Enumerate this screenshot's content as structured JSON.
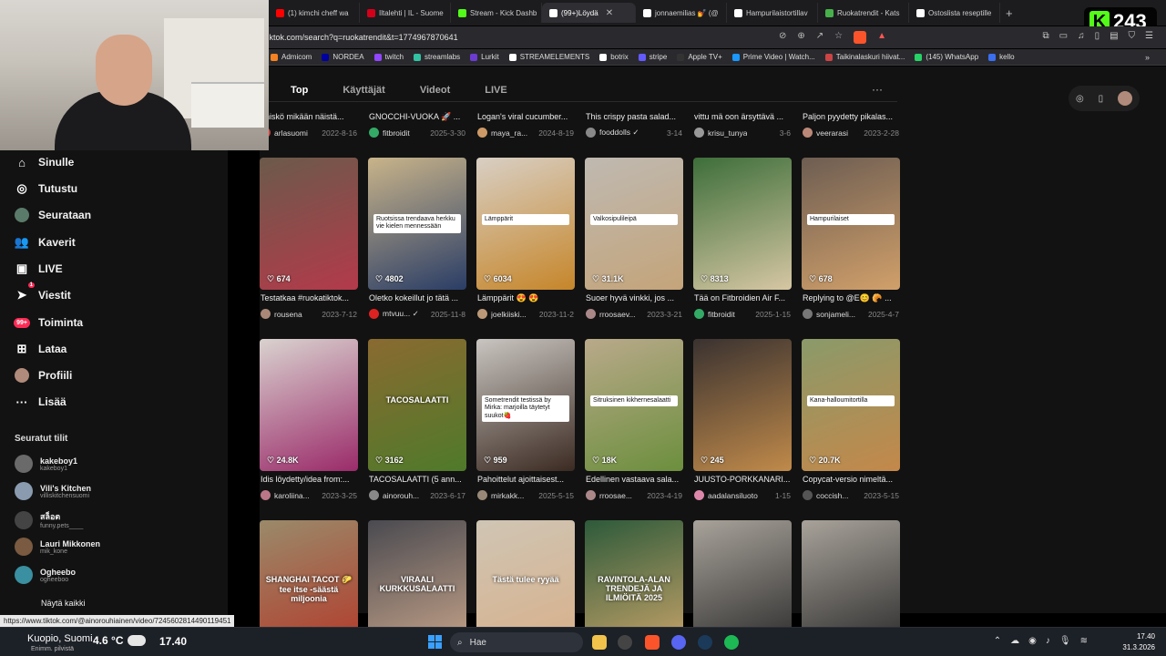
{
  "browser": {
    "tabs": [
      {
        "label": "(1) kimchi cheff wa",
        "color": "#ff0000",
        "active": false
      },
      {
        "label": "Iltalehti | IL - Suome",
        "color": "#d4001a",
        "active": false
      },
      {
        "label": "Stream - Kick Dashb",
        "color": "#53fc18",
        "active": false
      },
      {
        "label": "(99+)Löydä",
        "color": "#ffffff",
        "active": true
      },
      {
        "label": "jonnaemilias 💅 (@",
        "color": "#ffffff",
        "active": false
      },
      {
        "label": "Hampurilaistortillav",
        "color": "#ffffff",
        "active": false
      },
      {
        "label": "Ruokatrendit - Kats",
        "color": "#47b04b",
        "active": false
      },
      {
        "label": "Ostoslista reseptille",
        "color": "#ffffff",
        "active": false
      }
    ],
    "new_tab": "+",
    "kick_viewers": "243",
    "url": "tiktok.com/search?q=ruokatrendit&t=1774967870641",
    "bookmarks": [
      {
        "label": "Admicom",
        "color": "#f58220"
      },
      {
        "label": "NORDEA",
        "color": "#0000a0"
      },
      {
        "label": "twitch",
        "color": "#9146ff"
      },
      {
        "label": "streamlabs",
        "color": "#31c3a2"
      },
      {
        "label": "Lurkit",
        "color": "#6c3bd1"
      },
      {
        "label": "STREAMELEMENTS",
        "color": "#ffffff"
      },
      {
        "label": "botrix",
        "color": "#ffffff"
      },
      {
        "label": "stripe",
        "color": "#635bff"
      },
      {
        "label": "Apple TV+",
        "color": "#333333"
      },
      {
        "label": "Prime Video | Watch...",
        "color": "#1a98ff"
      },
      {
        "label": "Taikinalaskuri hiivat...",
        "color": "#cc4444"
      },
      {
        "label": "(145) WhatsApp",
        "color": "#25d366"
      },
      {
        "label": "kello",
        "color": "#3a6ff0"
      }
    ],
    "bookmarks_more": "»"
  },
  "sidebar": {
    "nav": [
      {
        "label": "Sinulle",
        "icon": "⌂",
        "badge": ""
      },
      {
        "label": "Tutustu",
        "icon": "◎",
        "badge": ""
      },
      {
        "label": "Seurataan",
        "icon": "●",
        "badge": ""
      },
      {
        "label": "Kaverit",
        "icon": "👥",
        "badge": ""
      },
      {
        "label": "LIVE",
        "icon": "▣",
        "badge": ""
      },
      {
        "label": "Viestit",
        "icon": "➤",
        "badge": "1"
      },
      {
        "label": "Toiminta",
        "icon": "●",
        "badge": "99+"
      },
      {
        "label": "Lataa",
        "icon": "⊞",
        "badge": ""
      },
      {
        "label": "Profiili",
        "icon": "●",
        "badge": ""
      },
      {
        "label": "Lisää",
        "icon": "···",
        "badge": ""
      }
    ],
    "followed_title": "Seuratut tilit",
    "accounts": [
      {
        "name": "kakeboy1",
        "handle": "kakeboy1",
        "color": "#6a6a6a"
      },
      {
        "name": "Vili's Kitchen",
        "handle": "villiskitchensuomi",
        "color": "#8a9bb0"
      },
      {
        "name": "สล็อต",
        "handle": "funny.pets____",
        "color": "#444444"
      },
      {
        "name": "Lauri Mikkonen",
        "handle": "mik_kone",
        "color": "#7a5a40"
      },
      {
        "name": "Ogheebo",
        "handle": "ogheeboo",
        "color": "#3a8fa0"
      }
    ],
    "show_all": "Näytä kaikki"
  },
  "search": {
    "tabs": [
      "Top",
      "Käyttäjät",
      "Videot",
      "LIVE"
    ],
    "more": "···",
    "rows": [
      {
        "cards": [
          {
            "caption": "eniskö mikään näistä...",
            "user": "arlasuomi",
            "date": "2022-8-16",
            "views": "",
            "av": "#c44"
          },
          {
            "caption": "GNOCCHI-VUOKA 🚀 ...",
            "user": "fitbroidit",
            "date": "2025-3-30",
            "views": "",
            "av": "#3a6"
          },
          {
            "caption": "Logan's viral cucumber...",
            "user": "maya_ra...",
            "date": "2024-8-19",
            "views": "",
            "av": "#c96"
          },
          {
            "caption": "This crispy pasta salad...",
            "user": "fooddolls ✓",
            "date": "3-14",
            "views": "",
            "av": "#888"
          },
          {
            "caption": "vittu mä oon ärsyttävä ...",
            "user": "krisu_tunya",
            "date": "3-6",
            "views": "",
            "av": "#999"
          },
          {
            "caption": "Paljon pyydetty pikalas...",
            "user": "veerarasi",
            "date": "2023-2-28",
            "views": "",
            "av": "#b87"
          }
        ]
      },
      {
        "cards": [
          {
            "caption": "Testatkaa #ruokatiktok...",
            "user": "rousena",
            "date": "2023-7-12",
            "views": "674",
            "av": "#a87",
            "bg": "#6b5a4a",
            "bg2": "#b33a4a",
            "overlay": ""
          },
          {
            "caption": "Oletko kokeillut jo tätä ...",
            "user": "mtvuu... ✓",
            "date": "2025-11-8",
            "views": "4802",
            "av": "#d22",
            "bg": "#c9b48a",
            "bg2": "#2a3d66",
            "overlay": "Ruotsissa trendaava herkku vie kielen mennessään"
          },
          {
            "caption": "Lämppärit 😍 😍",
            "user": "joelkiiski...",
            "date": "2023-11-2",
            "views": "6034",
            "av": "#b97",
            "bg": "#d8cfc4",
            "bg2": "#c6862a",
            "overlay": "Lämppärit"
          },
          {
            "caption": "Suoer hyvä vinkki, jos ...",
            "user": "rroosaev...",
            "date": "2023-3-21",
            "views": "31.1K",
            "av": "#a88",
            "bg": "#bfb9b1",
            "bg2": "#c4a47a",
            "overlay": "Valkosipulileipä"
          },
          {
            "caption": "Tää on Fitbroidien Air F...",
            "user": "fitbroidit",
            "date": "2025-1-15",
            "views": "8313",
            "av": "#3a6",
            "bg": "#3d6e3a",
            "bg2": "#d6c7a3",
            "overlay": ""
          },
          {
            "caption": "Replying to @E😊 🥐 ...",
            "user": "sonjameli...",
            "date": "2025-4-7",
            "views": "678",
            "av": "#777",
            "bg": "#6d5d52",
            "bg2": "#d1a06a",
            "overlay": "Hampurilaiset"
          }
        ]
      },
      {
        "cards": [
          {
            "caption": "Idis löydetty/idea from:...",
            "user": "karoliina...",
            "date": "2023-3-25",
            "views": "24.8K",
            "av": "#b78",
            "bg": "#d9d2cf",
            "bg2": "#9b2b6a",
            "overlay": ""
          },
          {
            "caption": "TACOSALAATTI (5 ann...",
            "user": "ainorouh...",
            "date": "2023-6-17",
            "views": "3162",
            "av": "#888",
            "bg": "#8a6a30",
            "bg2": "#4f7a2a",
            "overlay": "TACOSALAATTI"
          },
          {
            "caption": "Pahoittelut ajoittaisest...",
            "user": "mirkakk...",
            "date": "2025-5-15",
            "views": "959",
            "av": "#987",
            "bg": "#c9c5c0",
            "bg2": "#3b2a22",
            "overlay": "Sometrendit testissä by Mirka: marjoilla täytetyt suukot🍓"
          },
          {
            "caption": "Edellinen vastaava sala...",
            "user": "rroosae...",
            "date": "2023-4-19",
            "views": "18K",
            "av": "#a88",
            "bg": "#b9a98a",
            "bg2": "#6c8f3d",
            "overlay": "Sitruksinen kikhernesalaatti"
          },
          {
            "caption": "JUUSTO-PORKKANARI...",
            "user": "aadalansiluoto",
            "date": "1-15",
            "views": "245",
            "av": "#d8a",
            "bg": "#3a3230",
            "bg2": "#c08a4a",
            "overlay": ""
          },
          {
            "caption": "Copycat-versio nimeltä...",
            "user": "coccish...",
            "date": "2023-5-15",
            "views": "20.7K",
            "av": "#555",
            "bg": "#8a9a6a",
            "bg2": "#c4884a",
            "overlay": "Kana-halloumitortilla"
          }
        ]
      },
      {
        "cards": [
          {
            "caption": "",
            "user": "",
            "date": "",
            "views": "",
            "av": "#000",
            "bg": "#9a8a6a",
            "bg2": "#b33a2a",
            "overlay": "SHANGHAI TACOT 🌮 tee itse -säästä miljoonia"
          },
          {
            "caption": "",
            "user": "",
            "date": "",
            "views": "",
            "av": "#000",
            "bg": "#4a4a50",
            "bg2": "#c7a48a",
            "overlay": "VIRAALI KURKKUSALAATTI"
          },
          {
            "caption": "",
            "user": "",
            "date": "",
            "views": "",
            "av": "#000",
            "bg": "#cfc5b4",
            "bg2": "#d8b08a",
            "overlay": "Tästä tulee ryyää"
          },
          {
            "caption": "",
            "user": "",
            "date": "",
            "views": "",
            "av": "#000",
            "bg": "#2d5a3a",
            "bg2": "#c9a46a",
            "overlay": "RAVINTOLA-ALAN TRENDEJÄ JA ILMIÖITÄ 2025"
          },
          {
            "caption": "",
            "user": "",
            "date": "",
            "views": "",
            "av": "#000",
            "bg": "#a8a29a",
            "bg2": "#2a2a2a",
            "overlay": ""
          },
          {
            "caption": "",
            "user": "",
            "date": "",
            "views": "",
            "av": "#000",
            "bg": "#a8a29a",
            "bg2": "#2a2a2a",
            "overlay": ""
          }
        ]
      }
    ]
  },
  "status_url": "https://www.tiktok.com/@ainorouhiainen/video/7245602814490119451",
  "taskbar": {
    "location": "Kuopio, Suomi",
    "temp": "4.6 °C",
    "condition": "Enimm. pilvistä",
    "time_mid": "17.40",
    "search": "Hae",
    "clock_time": "17.40",
    "clock_date": "31.3.2026"
  }
}
